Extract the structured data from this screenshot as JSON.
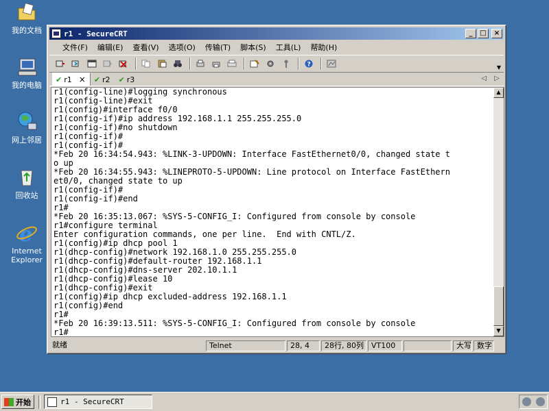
{
  "desktop": {
    "icons": [
      {
        "label": "我的文档",
        "icon": "folder-docs-icon"
      },
      {
        "label": "我的电脑",
        "icon": "computer-icon"
      },
      {
        "label": "网上邻居",
        "icon": "network-icon"
      },
      {
        "label": "回收站",
        "icon": "recycle-bin-icon"
      },
      {
        "label1": "Internet",
        "label2": "Explorer",
        "icon": "ie-icon"
      }
    ]
  },
  "window": {
    "title": "r1 - SecureCRT",
    "controls": {
      "minimize": "_",
      "maximize": "□",
      "close": "×"
    },
    "menu": [
      "文件(F)",
      "编辑(E)",
      "查看(V)",
      "选项(O)",
      "传输(T)",
      "脚本(S)",
      "工具(L)",
      "帮助(H)"
    ],
    "tabs": [
      {
        "label": "r1",
        "active": true,
        "close": "×"
      },
      {
        "label": "r2",
        "active": false
      },
      {
        "label": "r3",
        "active": false
      }
    ],
    "tab_nav": {
      "prev": "◁",
      "next": "▷"
    },
    "terminal_lines": [
      "r1(config-line)#logging synchronous",
      "r1(config-line)#exit",
      "r1(config)#interface f0/0",
      "r1(config-if)#ip address 192.168.1.1 255.255.255.0",
      "r1(config-if)#no shutdown",
      "r1(config-if)#",
      "r1(config-if)#",
      "*Feb 20 16:34:54.943: %LINK-3-UPDOWN: Interface FastEthernet0/0, changed state t",
      "o up",
      "*Feb 20 16:34:55.943: %LINEPROTO-5-UPDOWN: Line protocol on Interface FastEthern",
      "et0/0, changed state to up",
      "r1(config-if)#",
      "r1(config-if)#end",
      "r1#",
      "*Feb 20 16:35:13.067: %SYS-5-CONFIG_I: Configured from console by console",
      "r1#configure terminal",
      "Enter configuration commands, one per line.  End with CNTL/Z.",
      "r1(config)#ip dhcp pool 1",
      "r1(dhcp-config)#network 192.168.1.0 255.255.255.0",
      "r1(dhcp-config)#default-router 192.168.1.1",
      "r1(dhcp-config)#dns-server 202.10.1.1",
      "r1(dhcp-config)#lease 10",
      "r1(dhcp-config)#exit",
      "r1(config)#ip dhcp excluded-address 192.168.1.1",
      "r1(config)#end",
      "r1#",
      "*Feb 20 16:39:13.511: %SYS-5-CONFIG_I: Configured from console by console",
      "r1#"
    ],
    "status": {
      "ready": "就绪",
      "protocol": "Telnet",
      "cursor": "28,  4",
      "size": "28行, 80列",
      "emulation": "VT100",
      "caps": "大写",
      "num": "数字"
    }
  },
  "taskbar": {
    "start": "开始",
    "task": "r1 - SecureCRT"
  }
}
